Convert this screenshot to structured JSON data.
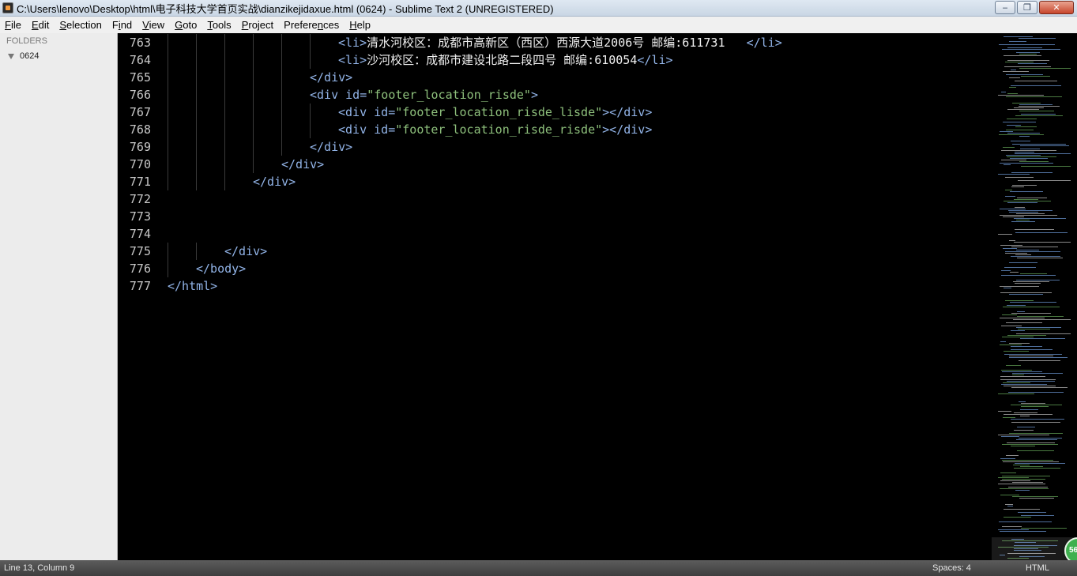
{
  "window": {
    "title": "C:\\Users\\lenovo\\Desktop\\html\\电子科技大学首页实战\\dianzikejidaxue.html (0624) - Sublime Text 2 (UNREGISTERED)",
    "minimize_label": "‒",
    "maximize_label": "❐",
    "close_label": "✕"
  },
  "menu": [
    {
      "pre": "",
      "u": "F",
      "post": "ile"
    },
    {
      "pre": "",
      "u": "E",
      "post": "dit"
    },
    {
      "pre": "",
      "u": "S",
      "post": "election"
    },
    {
      "pre": "F",
      "u": "i",
      "post": "nd"
    },
    {
      "pre": "",
      "u": "V",
      "post": "iew"
    },
    {
      "pre": "",
      "u": "G",
      "post": "oto"
    },
    {
      "pre": "",
      "u": "T",
      "post": "ools"
    },
    {
      "pre": "",
      "u": "P",
      "post": "roject"
    },
    {
      "pre": "Prefere",
      "u": "n",
      "post": "ces"
    },
    {
      "pre": "",
      "u": "H",
      "post": "elp"
    }
  ],
  "sidebar": {
    "header": "FOLDERS",
    "folder": "0624"
  },
  "editor": {
    "lines": [
      {
        "num": "763",
        "indent": 6,
        "tokens": [
          [
            "tag",
            "<li>"
          ],
          [
            "txt",
            "清水河校区：成都市高新区（西区）西源大道2006号 邮编:611731   "
          ],
          [
            "tag",
            "</li>"
          ]
        ]
      },
      {
        "num": "764",
        "indent": 6,
        "tokens": [
          [
            "tag",
            "<li>"
          ],
          [
            "txt",
            "沙河校区：成都市建设北路二段四号 邮编:610054"
          ],
          [
            "tag",
            "</li>"
          ]
        ]
      },
      {
        "num": "765",
        "indent": 5,
        "tokens": [
          [
            "tag",
            "</div>"
          ]
        ]
      },
      {
        "num": "766",
        "indent": 5,
        "tokens": [
          [
            "tag",
            "<div "
          ],
          [
            "attr",
            "id="
          ],
          [
            "str",
            "\"footer_location_risde\""
          ],
          [
            "tag",
            ">"
          ]
        ]
      },
      {
        "num": "767",
        "indent": 6,
        "tokens": [
          [
            "tag",
            "<div "
          ],
          [
            "attr",
            "id="
          ],
          [
            "str",
            "\"footer_location_risde_lisde\""
          ],
          [
            "tag",
            "></div>"
          ]
        ]
      },
      {
        "num": "768",
        "indent": 6,
        "tokens": [
          [
            "tag",
            "<div "
          ],
          [
            "attr",
            "id="
          ],
          [
            "str",
            "\"footer_location_risde_risde\""
          ],
          [
            "tag",
            "></div>"
          ]
        ]
      },
      {
        "num": "769",
        "indent": 5,
        "tokens": [
          [
            "tag",
            "</div>"
          ]
        ]
      },
      {
        "num": "770",
        "indent": 4,
        "tokens": [
          [
            "tag",
            "</div>"
          ]
        ]
      },
      {
        "num": "771",
        "indent": 3,
        "tokens": [
          [
            "tag",
            "</div>"
          ]
        ]
      },
      {
        "num": "772",
        "indent": 0,
        "tokens": []
      },
      {
        "num": "773",
        "indent": 0,
        "tokens": []
      },
      {
        "num": "774",
        "indent": 0,
        "tokens": []
      },
      {
        "num": "775",
        "indent": 2,
        "tokens": [
          [
            "tag",
            "</div>"
          ]
        ]
      },
      {
        "num": "776",
        "indent": 1,
        "tokens": [
          [
            "tag",
            "</body>"
          ]
        ]
      },
      {
        "num": "777",
        "indent": 0,
        "tokens": [
          [
            "tag",
            "</html>"
          ]
        ]
      }
    ],
    "colors": {
      "tag": "#92b4e8",
      "string": "#8ec07c",
      "text": "#f0f0f0",
      "background": "#000000"
    }
  },
  "status": {
    "position": "Line 13, Column 9",
    "spaces": "Spaces: 4",
    "syntax": "HTML"
  },
  "badge": {
    "label": "56"
  }
}
